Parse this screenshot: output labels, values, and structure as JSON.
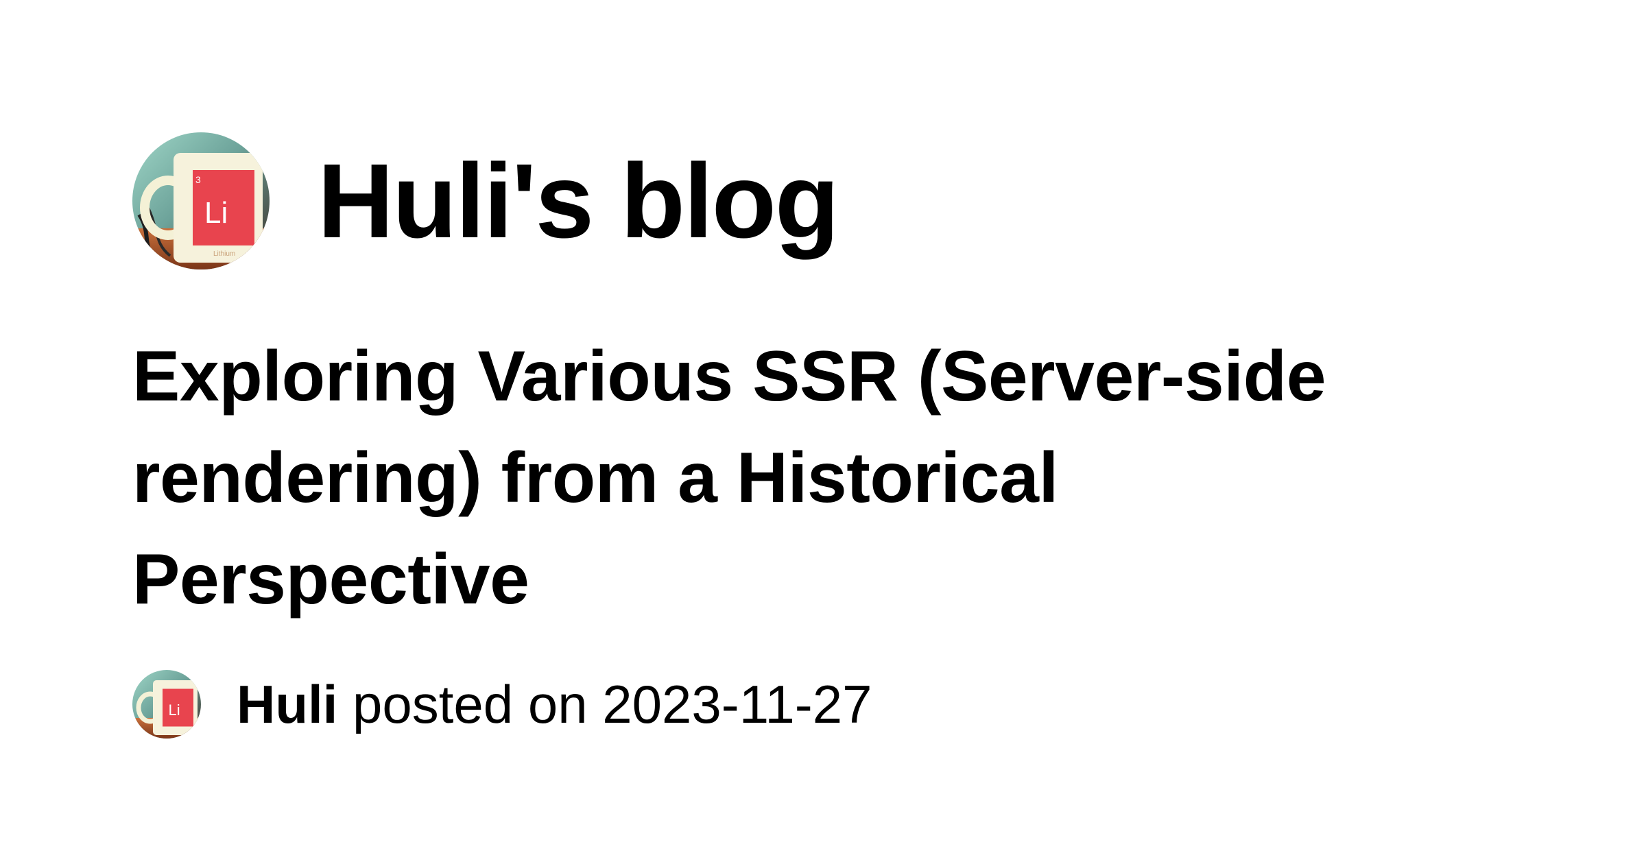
{
  "header": {
    "blog_title": "Huli's blog",
    "avatar_icon": "mug-avatar-icon",
    "avatar_mug_label": "Li",
    "avatar_mug_number": "3",
    "avatar_mug_subtext": "Lithium"
  },
  "post": {
    "title": "Exploring Various SSR (Server-side rendering) from a Historical Perspective",
    "author": "Huli",
    "posted_on": "posted on 2023-11-27"
  },
  "colors": {
    "background": "#ffffff",
    "text": "#000000",
    "mug_red": "#e8444e"
  }
}
